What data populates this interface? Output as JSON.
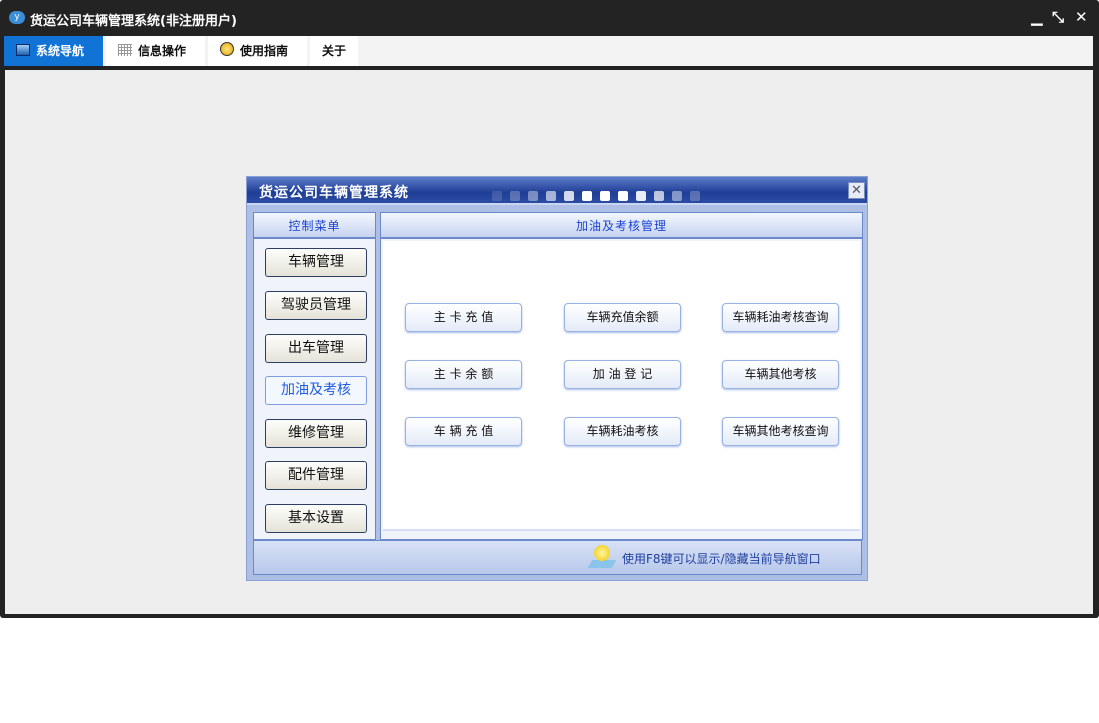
{
  "window": {
    "title": "货运公司车辆管理系统(非注册用户)",
    "logo": "yf",
    "controls": {
      "minimize": "▁",
      "restore": "⤡",
      "close": "✕"
    }
  },
  "tabs": [
    {
      "label": "系统导航",
      "icon": "monitor-icon"
    },
    {
      "label": "信息操作",
      "icon": "grid-icon"
    },
    {
      "label": "使用指南",
      "icon": "help-icon"
    },
    {
      "label": "关于"
    }
  ],
  "dialog": {
    "title": "货运公司车辆管理系统",
    "close": "✕",
    "left_header": "控制菜单",
    "menu": [
      "车辆管理",
      "驾驶员管理",
      "出车管理",
      "加油及考核",
      "维修管理",
      "配件管理",
      "基本设置"
    ],
    "selected_menu": 3,
    "right_header": "加油及考核管理",
    "actions": [
      [
        "主 卡 充 值",
        "车辆充值余额",
        "车辆耗油考核查询"
      ],
      [
        "主 卡 余 额",
        "加 油 登 记",
        "车辆其他考核"
      ],
      [
        "车 辆 充 值",
        "车辆耗油考核",
        "车辆其他考核查询"
      ]
    ],
    "footer": "使用F8键可以显示/隐藏当前导航窗口"
  }
}
